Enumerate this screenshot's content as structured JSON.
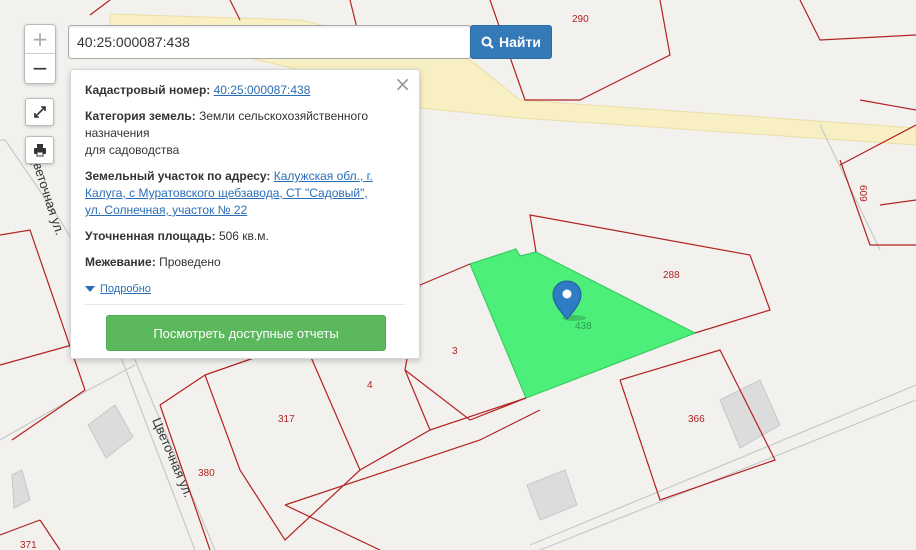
{
  "search": {
    "value": "40:25:000087:438",
    "button_label": "Найти"
  },
  "controls": {
    "zoom_in": "+",
    "zoom_out": "−",
    "fullscreen_icon": "expand-icon",
    "print_icon": "printer-icon"
  },
  "popup": {
    "close": "×",
    "cadastral_label": "Кадастровый номер:",
    "cadastral_value": "40:25:000087:438",
    "category_label": "Категория земель:",
    "category_line1": "Земли сельскохозяйственного",
    "category_line2": "назначения",
    "category_line3": "для садоводства",
    "address_label": "Земельный участок по адресу:",
    "address_value": "Калужская обл., г. Калуга, с Муратовского щебзавода, СТ \"Садовый\", ул. Солнечная, участок № 22",
    "area_label": "Уточненная площадь:",
    "area_value": "506 кв.м.",
    "survey_label": "Межевание:",
    "survey_value": "Проведено",
    "more_label": "Подробно",
    "reports_button": "Посмотреть доступные отчеты"
  },
  "map": {
    "selected_parcel": "438",
    "selected_fill_color": "#4cef7a",
    "parcel_border_color": "#b22222",
    "road_color": "#f8efc2",
    "parcel_labels": [
      "290",
      "609",
      "288",
      "3",
      "4",
      "317",
      "366",
      "380",
      "371"
    ],
    "street_labels": [
      "Цветочная ул.",
      "Цветочная ул."
    ]
  }
}
